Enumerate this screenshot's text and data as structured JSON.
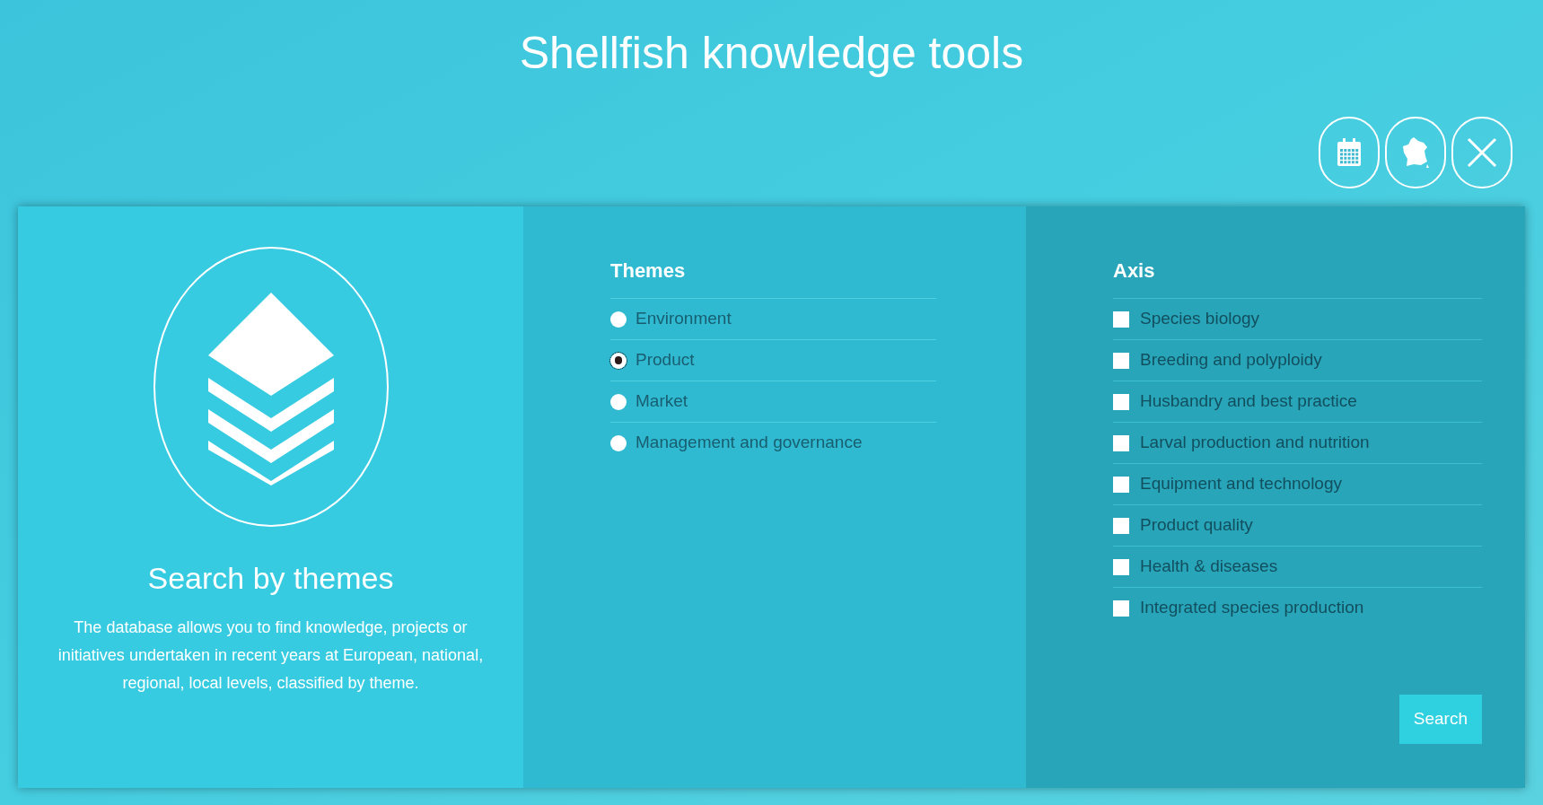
{
  "header": {
    "title": "Shellfish knowledge tools"
  },
  "toolbar": [
    {
      "kind": "calendar"
    },
    {
      "kind": "map"
    },
    {
      "kind": "close"
    }
  ],
  "intro": {
    "title": "Search by themes",
    "description": "The database allows you to find knowledge, projects or initiatives undertaken in recent years at European, national, regional, local levels, classified by theme."
  },
  "themes": {
    "title": "Themes",
    "options": [
      {
        "label": "Environment",
        "selected": false
      },
      {
        "label": "Product",
        "selected": true
      },
      {
        "label": "Market",
        "selected": false
      },
      {
        "label": "Management and governance",
        "selected": false
      }
    ]
  },
  "axis": {
    "title": "Axis",
    "options": [
      {
        "label": "Species biology",
        "checked": false
      },
      {
        "label": "Breeding and polyploidy",
        "checked": false
      },
      {
        "label": "Husbandry and best practice",
        "checked": false
      },
      {
        "label": "Larval production and nutrition",
        "checked": false
      },
      {
        "label": "Equipment and technology",
        "checked": false
      },
      {
        "label": "Product quality",
        "checked": false
      },
      {
        "label": "Health & diseases",
        "checked": false
      },
      {
        "label": "Integrated species production",
        "checked": false
      }
    ]
  },
  "search_button": "Search"
}
